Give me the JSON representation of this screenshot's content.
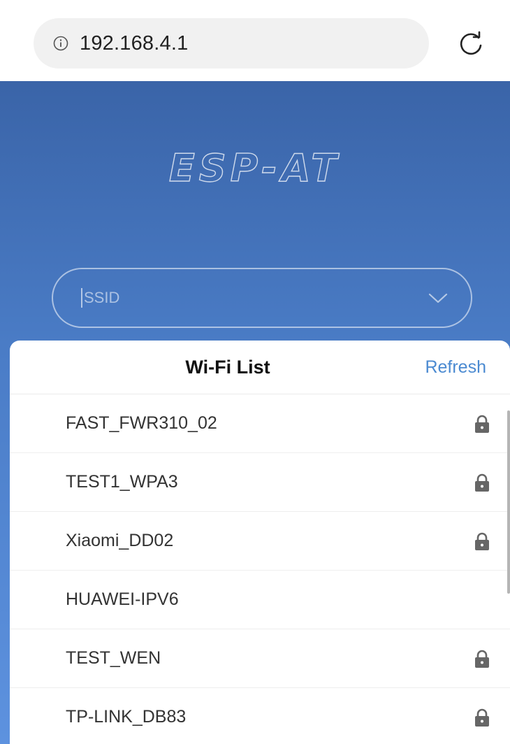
{
  "browser": {
    "url": "192.168.4.1"
  },
  "app": {
    "logo_text": "ESP-AT",
    "ssid_placeholder": "SSID"
  },
  "wifi_list": {
    "title": "Wi-Fi List",
    "refresh_label": "Refresh",
    "networks": [
      {
        "ssid": "FAST_FWR310_02",
        "secured": true
      },
      {
        "ssid": "TEST1_WPA3",
        "secured": true
      },
      {
        "ssid": "Xiaomi_DD02",
        "secured": true
      },
      {
        "ssid": "HUAWEI-IPV6",
        "secured": false
      },
      {
        "ssid": "TEST_WEN",
        "secured": true
      },
      {
        "ssid": "TP-LINK_DB83",
        "secured": true
      }
    ]
  },
  "colors": {
    "header_blue": "#3a64a8",
    "link_blue": "#4b8ad1"
  },
  "icons": {
    "info": "info-icon",
    "reload": "reload-icon",
    "dropdown": "chevron-down-icon",
    "secured": "lock-icon"
  }
}
